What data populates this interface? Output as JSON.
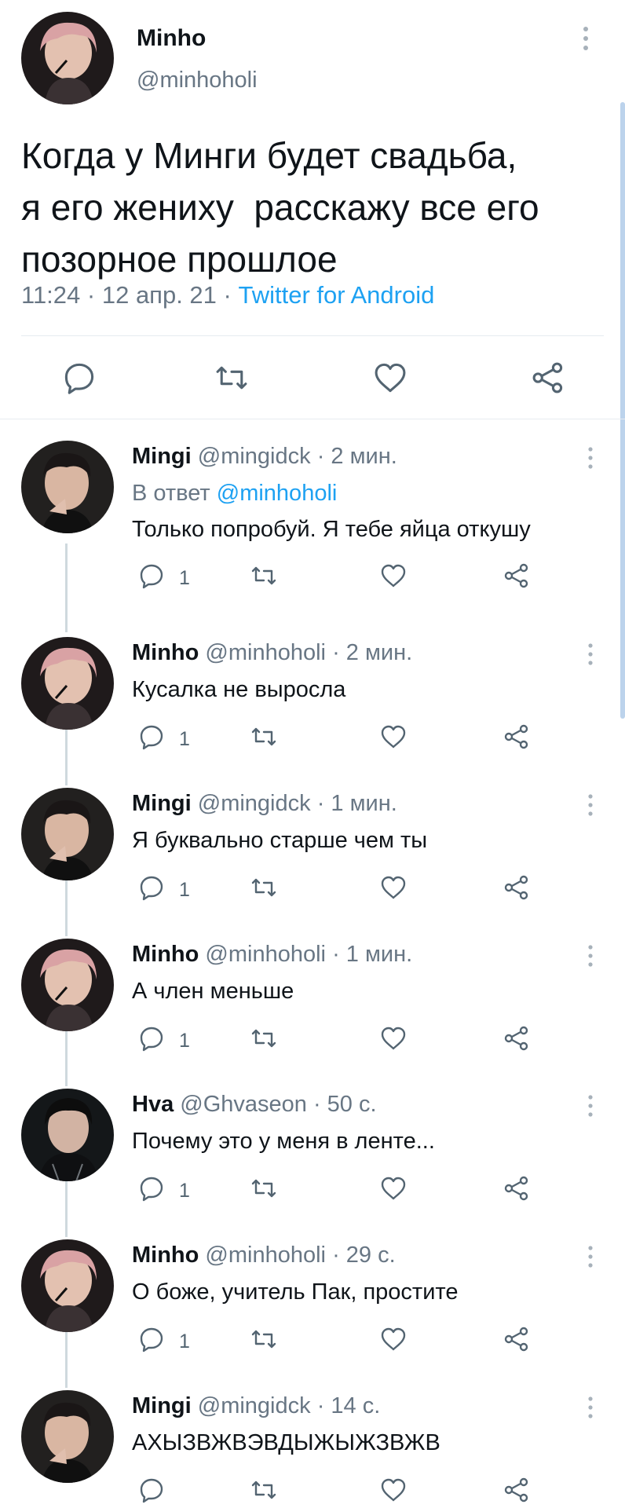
{
  "main_tweet": {
    "name": "Minho",
    "handle": "@minhoholi",
    "text_lines": [
      "Когда у Минги будет свадьба,",
      "я его жениху  расскажу все его",
      "позорное прошлое"
    ],
    "time": "11:24",
    "date": "12 апр. 21",
    "sep": " · ",
    "app": "Twitter for Android"
  },
  "replies": [
    {
      "name": "Mingi",
      "handle": "@mingidck",
      "time": "· 2 мин.",
      "replying_label": "В ответ",
      "replying_to": "@minhoholi",
      "text": "Только попробуй. Я тебе яйца откушу",
      "reply_count": "1",
      "avatar": "mingi"
    },
    {
      "name": "Minho",
      "handle": "@minhoholi",
      "time": "· 2 мин.",
      "text": "Кусалка не выросла",
      "reply_count": "1",
      "avatar": "minho"
    },
    {
      "name": "Mingi",
      "handle": "@mingidck",
      "time": "· 1 мин.",
      "text": "Я буквально старше чем ты",
      "reply_count": "1",
      "avatar": "mingi"
    },
    {
      "name": "Minho",
      "handle": "@minhoholi",
      "time": "· 1 мин.",
      "text": "А член меньше",
      "reply_count": "1",
      "avatar": "minho"
    },
    {
      "name": "Hva",
      "handle": "@Ghvaseon",
      "time": "· 50 с.",
      "text": "Почему это у меня в ленте...",
      "reply_count": "1",
      "avatar": "hva"
    },
    {
      "name": "Minho",
      "handle": "@minhoholi",
      "time": "· 29 с.",
      "text": "О боже, учитель Пак, простите",
      "reply_count": "1",
      "avatar": "minho"
    },
    {
      "name": "Mingi",
      "handle": "@mingidck",
      "time": "· 14 с.",
      "text": "АХЫЗВЖВЭВДЫЖЫЖЗВЖВ",
      "reply_count": "",
      "avatar": "mingi"
    }
  ],
  "icons": {
    "reply": "reply-icon",
    "retweet": "retweet-icon",
    "like": "like-icon",
    "share": "share-icon",
    "more": "more-vertical-icon"
  },
  "colors": {
    "link": "#1da1f2",
    "secondary": "#687684",
    "icon": "#536471",
    "divider": "#e6ecf0",
    "thread_line": "#cfd9de"
  }
}
